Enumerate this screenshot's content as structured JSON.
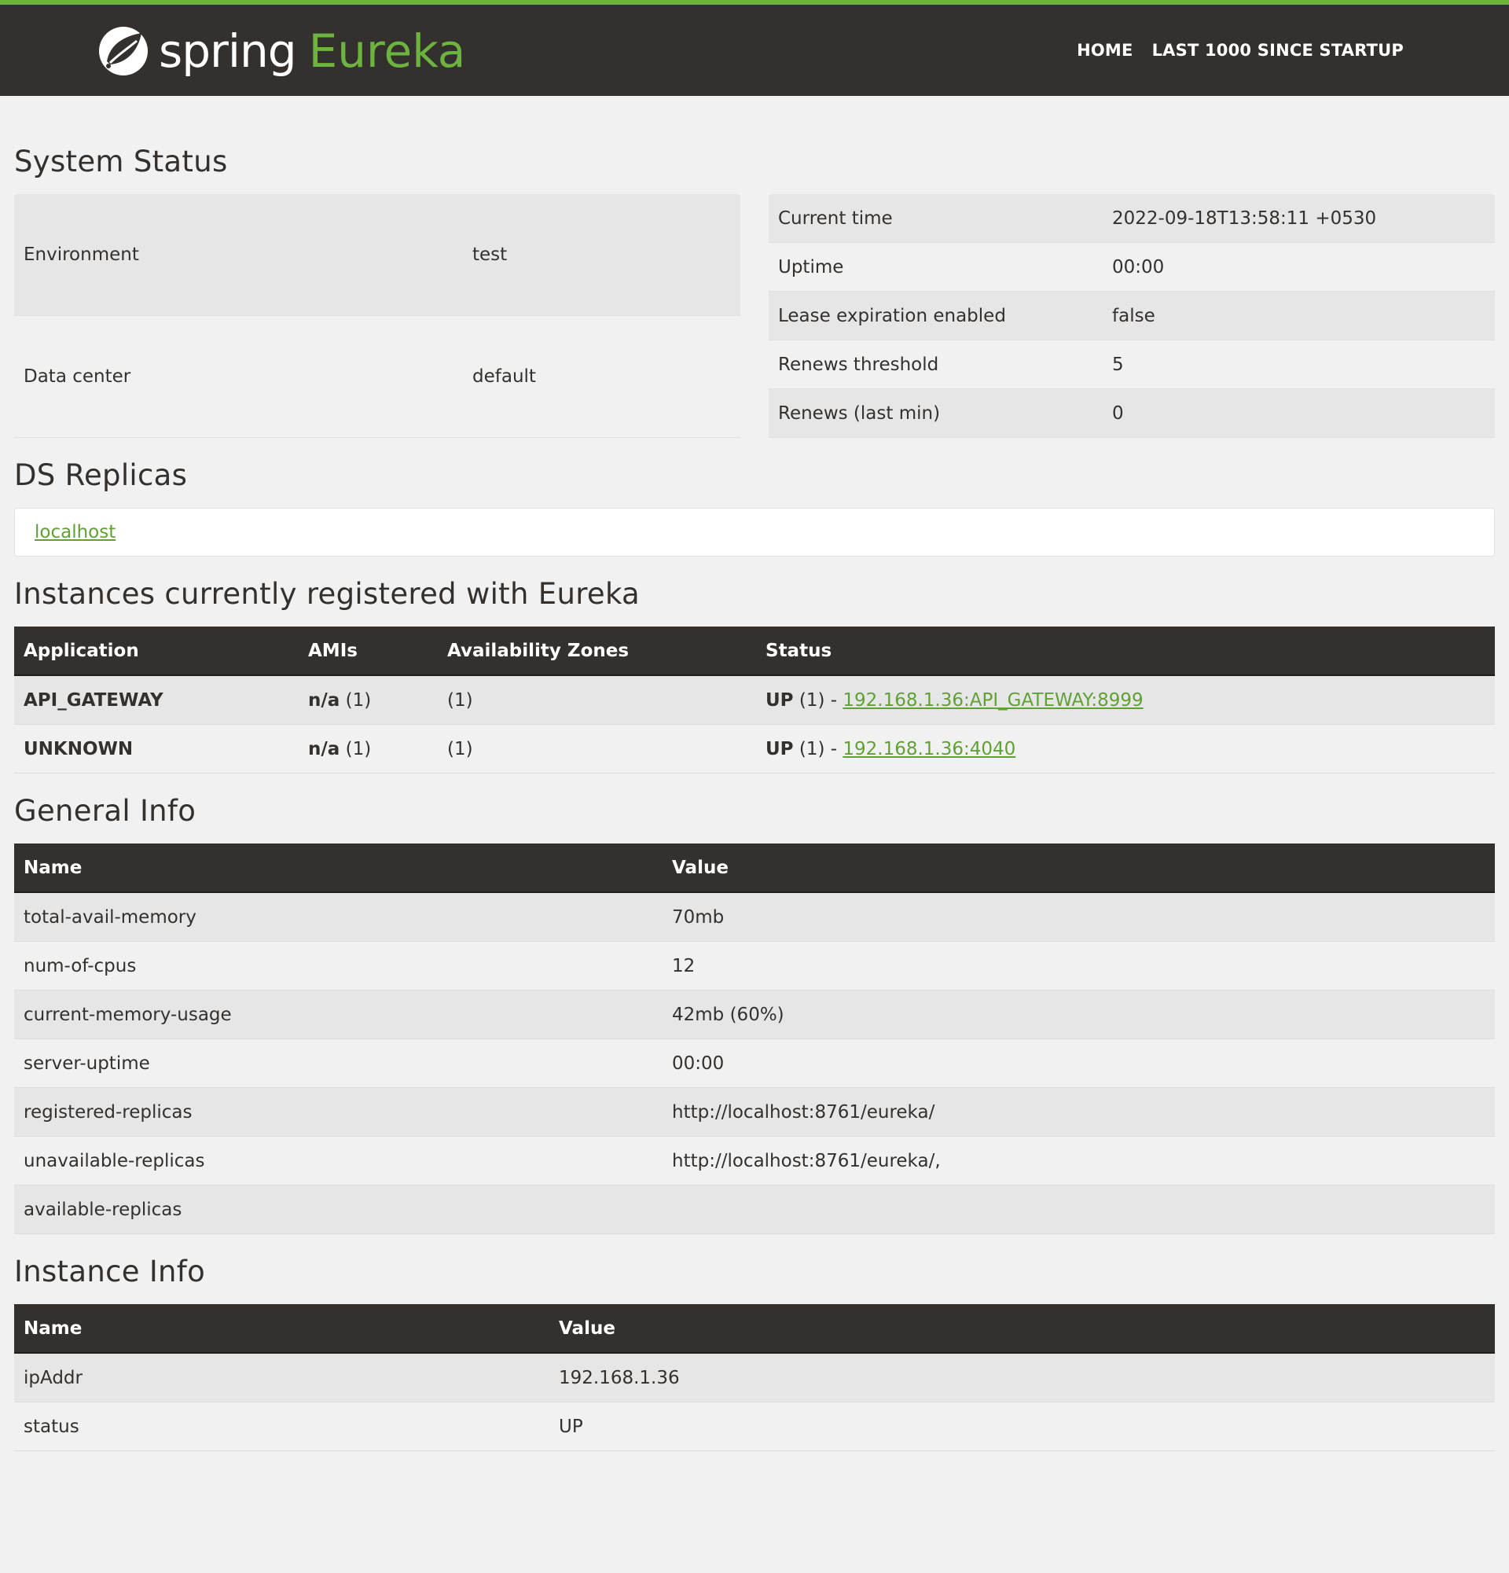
{
  "brand": {
    "spring": "spring",
    "eureka": "Eureka"
  },
  "nav": {
    "home": "HOME",
    "last1000": "LAST 1000 SINCE STARTUP"
  },
  "system_status": {
    "title": "System Status",
    "left": [
      {
        "label": "Environment",
        "value": "test"
      },
      {
        "label": "Data center",
        "value": "default"
      }
    ],
    "right": [
      {
        "label": "Current time",
        "value": "2022-09-18T13:58:11 +0530"
      },
      {
        "label": "Uptime",
        "value": "00:00"
      },
      {
        "label": "Lease expiration enabled",
        "value": "false"
      },
      {
        "label": "Renews threshold",
        "value": "5"
      },
      {
        "label": "Renews (last min)",
        "value": "0"
      }
    ]
  },
  "ds_replicas": {
    "title": "DS Replicas",
    "link": "localhost"
  },
  "instances": {
    "title": "Instances currently registered with Eureka",
    "headers": [
      "Application",
      "AMIs",
      "Availability Zones",
      "Status"
    ],
    "rows": [
      {
        "app": "API_GATEWAY",
        "ami_bold": "n/a",
        "ami_count": " (1)",
        "zones": "(1)",
        "status_bold": "UP",
        "status_text": " (1) - ",
        "link": "192.168.1.36:API_GATEWAY:8999"
      },
      {
        "app": "UNKNOWN",
        "ami_bold": "n/a",
        "ami_count": " (1)",
        "zones": "(1)",
        "status_bold": "UP",
        "status_text": " (1) - ",
        "link": "192.168.1.36:4040"
      }
    ]
  },
  "general_info": {
    "title": "General Info",
    "headers": [
      "Name",
      "Value"
    ],
    "rows": [
      {
        "name": "total-avail-memory",
        "value": "70mb"
      },
      {
        "name": "num-of-cpus",
        "value": "12"
      },
      {
        "name": "current-memory-usage",
        "value": "42mb (60%)"
      },
      {
        "name": "server-uptime",
        "value": "00:00"
      },
      {
        "name": "registered-replicas",
        "value": "http://localhost:8761/eureka/"
      },
      {
        "name": "unavailable-replicas",
        "value": "http://localhost:8761/eureka/,"
      },
      {
        "name": "available-replicas",
        "value": ""
      }
    ]
  },
  "instance_info": {
    "title": "Instance Info",
    "headers": [
      "Name",
      "Value"
    ],
    "rows": [
      {
        "name": "ipAddr",
        "value": "192.168.1.36"
      },
      {
        "name": "status",
        "value": "UP"
      }
    ]
  },
  "colors": {
    "brand_green": "#6db33f",
    "nav_bg": "#34302d",
    "link_green": "#5fa134"
  }
}
